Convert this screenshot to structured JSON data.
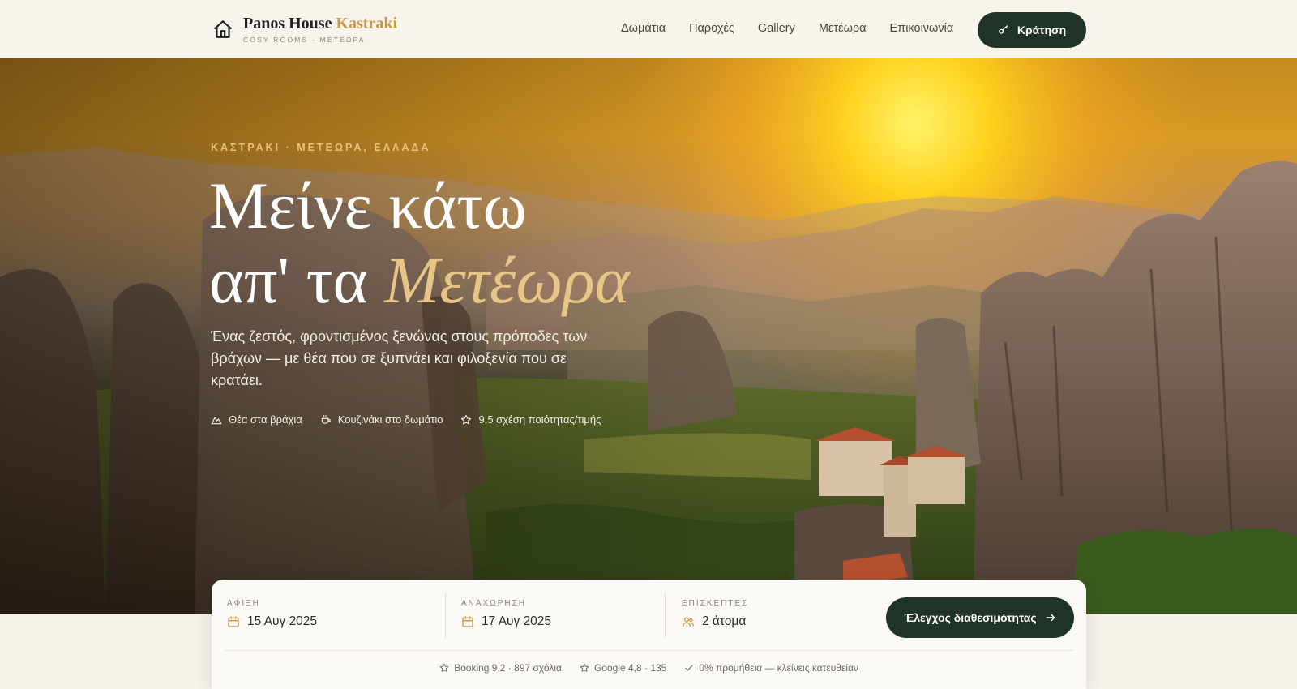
{
  "brand": {
    "name": "Panos House",
    "name_accent": "Kastraki",
    "tagline": "COSY ROOMS · ΜΕΤΕΩΡΑ",
    "icon": "house-icon"
  },
  "nav": {
    "links": [
      "Δωμάτια",
      "Παροχές",
      "Gallery",
      "Μετέωρα",
      "Επικοινωνία"
    ],
    "book_label": "Κράτηση",
    "book_icon": "key-icon"
  },
  "hero": {
    "kicker": "ΚΑΣΤΡΑΚΙ · ΜΕΤΕΩΡΑ, ΕΛΛΑΔΑ",
    "title_line1": "Μείνε κάτω",
    "title_line2_plain": "απ' τα",
    "title_line2_accent": "Μετέωρα",
    "lead": "Ένας ζεστός, φροντισμένος ξενώνας στους πρόποδες των βράχων — με θέα που σε ξυπνάει και φιλοξενία που σε κρατάει.",
    "features": [
      {
        "icon": "mountain-icon",
        "label": "Θέα στα βράχια"
      },
      {
        "icon": "cup-icon",
        "label": "Κουζινάκι στο δωμάτιο"
      },
      {
        "icon": "star-icon",
        "label": "9,5 σχέση ποιότητας/τιμής"
      }
    ]
  },
  "booking": {
    "arrival": {
      "label": "ΑΦΙΞΗ",
      "value": "15 Αυγ 2025",
      "icon": "calendar-icon"
    },
    "departure": {
      "label": "ΑΝΑΧΩΡΗΣΗ",
      "value": "17 Αυγ 2025",
      "icon": "calendar-icon"
    },
    "guests": {
      "label": "ΕΠΙΣΚΕΠΤΕΣ",
      "value": "2 άτομα",
      "icon": "users-icon"
    },
    "check_label": "Έλεγχος διαθεσιμότητας",
    "ratings": [
      {
        "icon": "star-icon",
        "text": "Booking 9,2 · 897 σχόλια"
      },
      {
        "icon": "star-icon",
        "text": "Google 4,8 · 135"
      },
      {
        "icon": "check-icon",
        "text": "0% προμήθεια — κλείνεις κατευθείαν"
      }
    ]
  },
  "colors": {
    "primary": "#1f3326",
    "accent": "#c9974a",
    "gold": "#e6c586",
    "background": "#f6f3ec"
  }
}
